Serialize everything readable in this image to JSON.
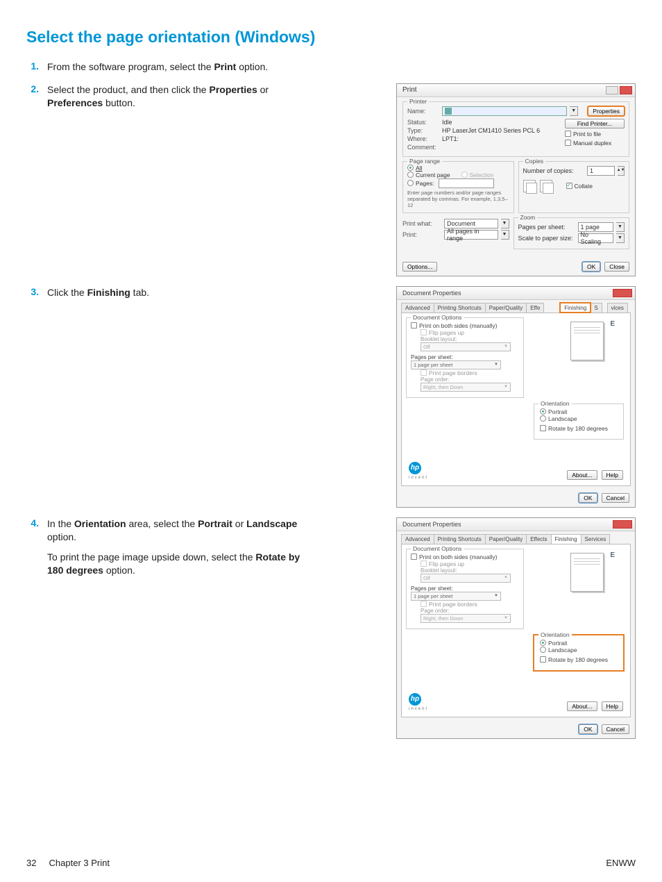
{
  "heading": "Select the page orientation (Windows)",
  "steps": {
    "s1": {
      "num": "1.",
      "text_a": "From the software program, select the ",
      "bold_a": "Print",
      "text_b": " option."
    },
    "s2": {
      "num": "2.",
      "text_a": "Select the product, and then click the ",
      "bold_a": "Properties",
      "text_b": " or ",
      "bold_b": "Preferences",
      "text_c": " button."
    },
    "s3": {
      "num": "3.",
      "text_a": "Click the ",
      "bold_a": "Finishing",
      "text_b": " tab."
    },
    "s4": {
      "num": "4.",
      "p1_a": "In the ",
      "p1_b": "Orientation",
      "p1_c": " area, select the ",
      "p1_d": "Portrait",
      "p1_e": " or ",
      "p1_f": "Landscape",
      "p1_g": " option.",
      "p2_a": "To print the page image upside down, select the ",
      "p2_b": "Rotate by 180 degrees",
      "p2_c": " option."
    }
  },
  "print_dialog": {
    "title": "Print",
    "printer": {
      "group": "Printer",
      "name_lbl": "Name:",
      "status_lbl": "Status:",
      "status_val": "Idle",
      "type_lbl": "Type:",
      "type_val": "HP LaserJet CM1410 Series PCL 6",
      "where_lbl": "Where:",
      "where_val": "LPT1:",
      "comment_lbl": "Comment:",
      "properties_btn": "Properties",
      "find_btn": "Find Printer...",
      "print_to_file": "Print to file",
      "manual_duplex": "Manual duplex"
    },
    "range": {
      "group": "Page range",
      "all": "All",
      "current": "Current page",
      "selection": "Selection",
      "pages": "Pages:",
      "hint": "Enter page numbers and/or page ranges separated by commas. For example, 1,3,5–12"
    },
    "copies": {
      "group": "Copies",
      "num_lbl": "Number of copies:",
      "num_val": "1",
      "collate": "Collate"
    },
    "printwhat": {
      "lbl": "Print what:",
      "val": "Document",
      "print_lbl": "Print:",
      "print_val": "All pages in range"
    },
    "zoom": {
      "group": "Zoom",
      "pps_lbl": "Pages per sheet:",
      "pps_val": "1 page",
      "scale_lbl": "Scale to paper size:",
      "scale_val": "No Scaling"
    },
    "options_btn": "Options...",
    "ok": "OK",
    "close": "Close"
  },
  "props_dialog": {
    "title": "Document Properties",
    "tabs": {
      "adv": "Advanced",
      "ps": "Printing Shortcuts",
      "pq": "Paper/Quality",
      "eff": "Effects",
      "fin": "Finishing",
      "svc": "Services",
      "s_short": "S",
      "vices_short": "vices",
      "effe_short": "Effe"
    },
    "doc_options": {
      "group": "Document Options",
      "print_both": "Print on both sides (manually)",
      "flip": "Flip pages up",
      "booklet_lbl": "Booklet layout:",
      "booklet_val": "Off",
      "pps_lbl": "Pages per sheet:",
      "pps_val": "1 page per sheet",
      "borders": "Print page borders",
      "order_lbl": "Page order:",
      "order_val": "Right, then Down"
    },
    "orientation": {
      "group": "Orientation",
      "portrait": "Portrait",
      "landscape": "Landscape",
      "rotate": "Rotate by 180 degrees"
    },
    "about": "About...",
    "help": "Help",
    "ok": "OK",
    "cancel": "Cancel",
    "hp": "hp",
    "invent": "invent"
  },
  "footer": {
    "left_num": "32",
    "left_text": "Chapter 3   Print",
    "right": "ENWW"
  }
}
